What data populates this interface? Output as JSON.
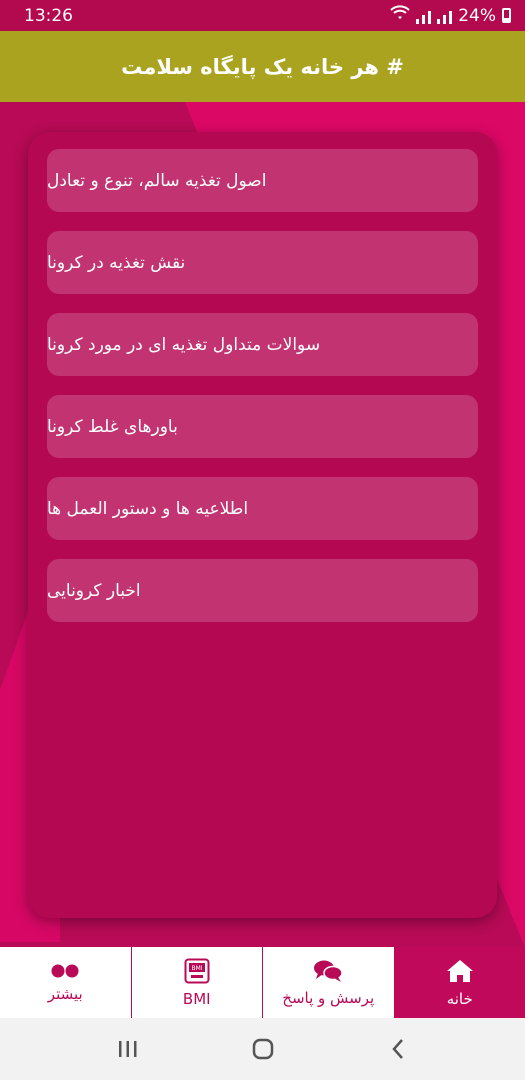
{
  "status_bar": {
    "time": "13:26",
    "battery": "24%"
  },
  "header": {
    "title": "# هر خانه یک پایگاه سلامت"
  },
  "menu": {
    "items": [
      {
        "label": "اصول تغذیه سالم، تنوع و تعادل"
      },
      {
        "label": "نقش تغذیه در کرونا"
      },
      {
        "label": "سوالات متداول تغذیه ای در مورد کرونا"
      },
      {
        "label": "باورهای غلط کرونا"
      },
      {
        "label": "اطلاعیه ها و دستور العمل ها"
      },
      {
        "label": "اخبار کرونایی"
      }
    ]
  },
  "bottom_nav": {
    "tabs": [
      {
        "label": "بیشتر",
        "icon": "dots-icon"
      },
      {
        "label": "BMI",
        "icon": "bmi-scale-icon",
        "icon_text": "BMI"
      },
      {
        "label": "پرسش و پاسخ",
        "icon": "chat-bubbles-icon"
      },
      {
        "label": "خانه",
        "icon": "home-icon",
        "active": true
      }
    ]
  },
  "colors": {
    "primary": "#b80a56",
    "title_bar": "#a9a320",
    "accent": "#dc0866"
  }
}
